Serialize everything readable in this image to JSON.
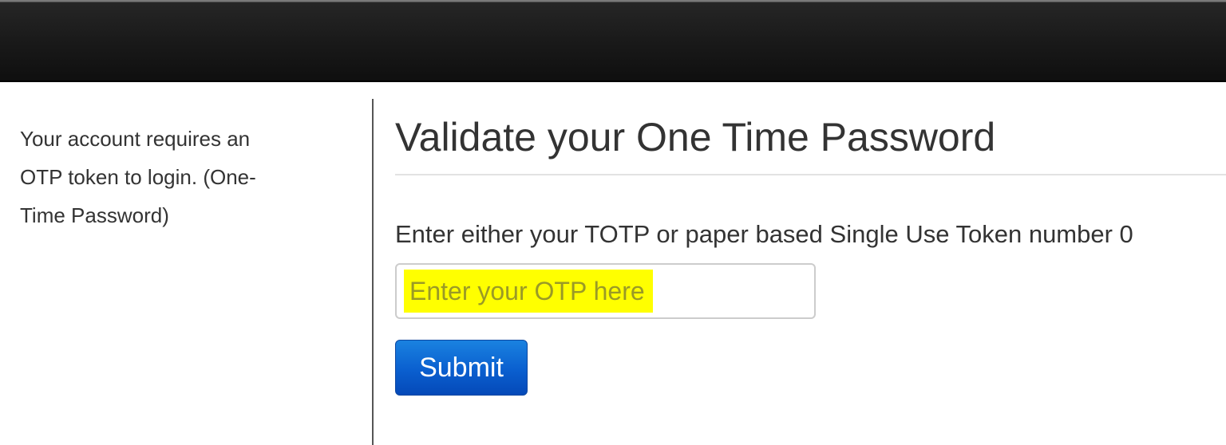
{
  "sidebar": {
    "message": "Your account requires an OTP token to login. (One-Time Password)"
  },
  "main": {
    "title": "Validate your One Time Password",
    "prompt": "Enter either your TOTP or paper based Single Use Token number 0",
    "otp_field": {
      "value": "",
      "placeholder": "Enter your OTP here",
      "highlight_color": "#ffff00"
    },
    "submit_label": "Submit",
    "submit_color": "#0a5fcf"
  }
}
